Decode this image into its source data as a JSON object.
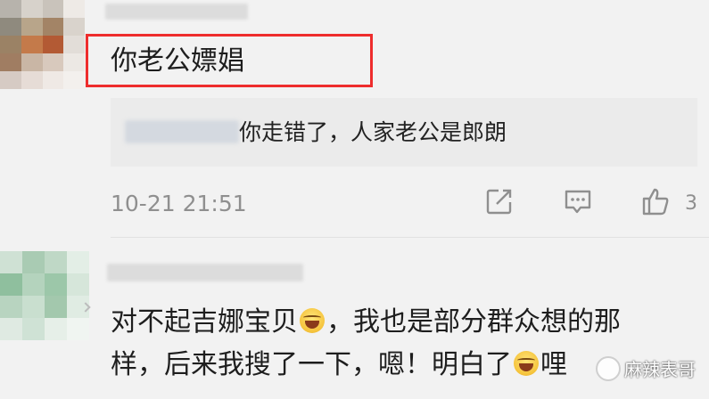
{
  "comment1": {
    "text": "你老公嫖娼",
    "reply": {
      "text": "你走错了，人家老公是郎朗"
    },
    "time": "10-21 21:51",
    "likes": "3",
    "icons": [
      "share-icon",
      "comment-icon",
      "thumbs-up-icon"
    ]
  },
  "comment2": {
    "line1_part1": "对不起吉娜宝贝",
    "line1_part2": "，我也是部分群众想的那",
    "line2_part1": "样，后来我搜了一下，嗯！明白了",
    "line2_part2": "哩",
    "emoji": "laughing-tears-emoji"
  },
  "watermark": {
    "text": "麻辣表哥"
  },
  "colors": {
    "background": "#f2f2f2",
    "highlight": "#ee2d2d",
    "meta": "#8f8f8f",
    "reply_bg": "#ebebeb"
  }
}
